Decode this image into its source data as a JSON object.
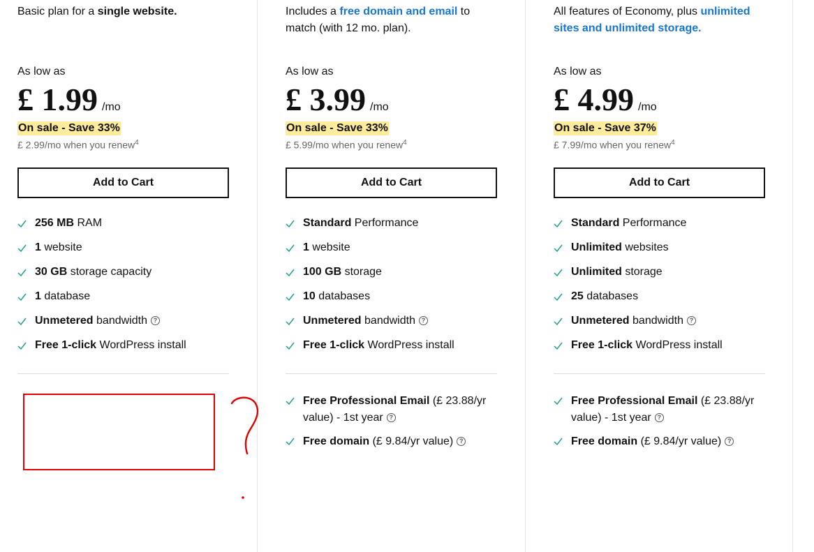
{
  "plans": [
    {
      "desc_prefix": "Basic plan for a ",
      "desc_bold": "single website.",
      "as_low_as": "As low as",
      "price": "£ 1.99",
      "per": "/mo",
      "sale": "On sale - Save 33%",
      "renew": "£ 2.99/mo when you renew",
      "renew_sup": "4",
      "cta": "Add to Cart",
      "features": [
        {
          "bold": "256 MB",
          "rest": " RAM"
        },
        {
          "bold": "1",
          "rest": " website"
        },
        {
          "bold": "30 GB",
          "rest": " storage capacity"
        },
        {
          "bold": "1",
          "rest": " database"
        },
        {
          "bold": "Unmetered",
          "rest": " bandwidth"
        },
        {
          "bold": "Free 1-click",
          "rest": " WordPress install"
        }
      ]
    },
    {
      "desc_prefix": "Includes a ",
      "desc_link": "free domain and email",
      "desc_suffix": " to match (with 12 mo. plan).",
      "as_low_as": "As low as",
      "price": "£ 3.99",
      "per": "/mo",
      "sale": "On sale - Save 33%",
      "renew": "£ 5.99/mo when you renew",
      "renew_sup": "4",
      "cta": "Add to Cart",
      "features": [
        {
          "bold": "Standard",
          "rest": " Performance"
        },
        {
          "bold": "1",
          "rest": " website"
        },
        {
          "bold": "100 GB",
          "rest": " storage"
        },
        {
          "bold": "10",
          "rest": " databases"
        },
        {
          "bold": "Unmetered",
          "rest": " bandwidth"
        },
        {
          "bold": "Free 1-click",
          "rest": " WordPress install"
        }
      ],
      "extras": [
        {
          "bold": "Free Professional Email",
          "rest": " (£ 23.88/yr value) - 1st year"
        },
        {
          "bold": "Free domain",
          "rest": " (£ 9.84/yr value)"
        }
      ]
    },
    {
      "desc_prefix": "All features of Economy, plus ",
      "desc_link": "unlimited sites and unlimited storage.",
      "as_low_as": "As low as",
      "price": "£ 4.99",
      "per": "/mo",
      "sale": "On sale - Save 37%",
      "renew": "£ 7.99/mo when you renew",
      "renew_sup": "4",
      "cta": "Add to Cart",
      "features": [
        {
          "bold": "Standard",
          "rest": " Performance"
        },
        {
          "bold": "Unlimited",
          "rest": " websites"
        },
        {
          "bold": "Unlimited",
          "rest": " storage"
        },
        {
          "bold": "25",
          "rest": " databases"
        },
        {
          "bold": "Unmetered",
          "rest": " bandwidth"
        },
        {
          "bold": "Free 1-click",
          "rest": " WordPress install"
        }
      ],
      "extras": [
        {
          "bold": "Free Professional Email",
          "rest": " (£ 23.88/yr value) - 1st year"
        },
        {
          "bold": "Free domain",
          "rest": " (£ 9.84/yr value)"
        }
      ]
    }
  ],
  "colors": {
    "check": "#2a9d8f",
    "link": "#1976d2",
    "sale_bg": "#ffeb9c",
    "annotation": "#e00000"
  },
  "icons": {
    "feature": "check-icon",
    "help": "help-icon"
  }
}
